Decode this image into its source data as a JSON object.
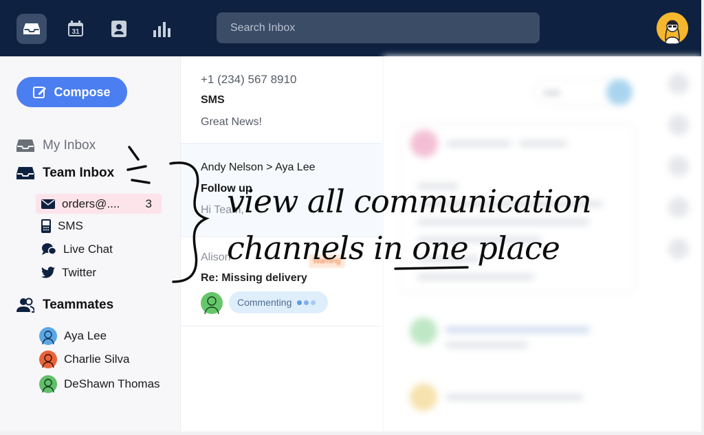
{
  "search": {
    "placeholder": "Search Inbox"
  },
  "topbar": {
    "icons": [
      "inbox-icon",
      "calendar-icon",
      "contacts-icon",
      "analytics-icon"
    ],
    "calendar_day": "31"
  },
  "sidebar": {
    "compose_label": "Compose",
    "my_inbox": "My Inbox",
    "team_inbox": "Team Inbox",
    "channels": [
      {
        "icon": "mail-icon",
        "label": "orders@....",
        "count": "3"
      },
      {
        "icon": "sms-icon",
        "label": "SMS"
      },
      {
        "icon": "chat-icon",
        "label": "Live Chat"
      },
      {
        "icon": "twitter-icon",
        "label": "Twitter"
      }
    ],
    "teammates_heading": "Teammates",
    "teammates": [
      {
        "name": "Aya Lee",
        "color": "#5aa7e6"
      },
      {
        "name": "Charlie Silva",
        "color": "#e8633a"
      },
      {
        "name": "DeShawn Thomas",
        "color": "#5fbf6a"
      }
    ]
  },
  "conversations": [
    {
      "from": "+1 (234) 567 8910",
      "channel": "SMS",
      "preview": "Great News!"
    },
    {
      "from": "Andy Nelson > Aya Lee",
      "subject": "Follow up",
      "preview": "Hi Team,"
    },
    {
      "from": "Alison",
      "tag": "Warning",
      "subject": "Re: Missing delivery",
      "status": "Commenting"
    }
  ],
  "annotation": {
    "line1": "view all communication",
    "line2_a": "channels in",
    "line2_b": "one",
    "line2_c": "place"
  },
  "colors": {
    "topbar": "#0e2140",
    "accent": "#4b7ef0",
    "selected_row": "#fde4ea"
  }
}
